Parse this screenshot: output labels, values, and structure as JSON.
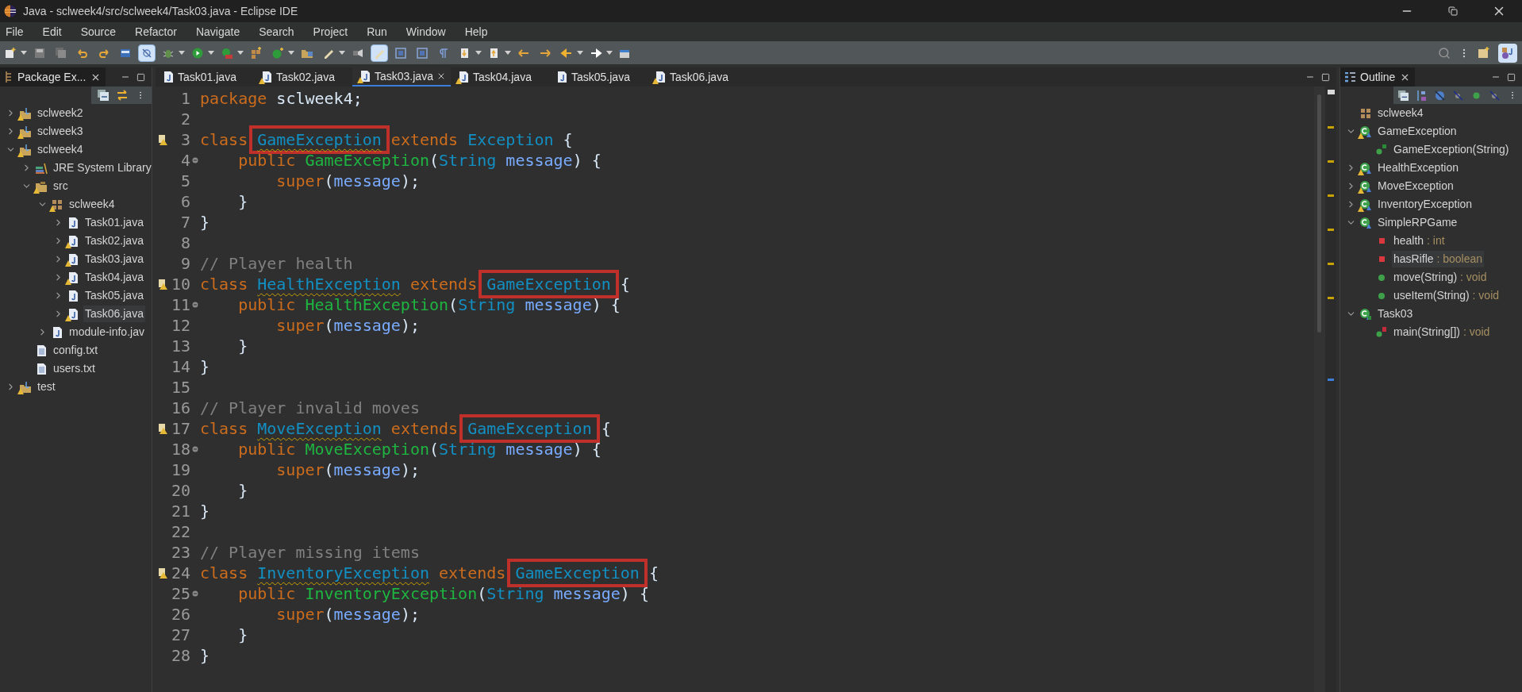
{
  "window": {
    "title": "Java - sclweek4/src/sclweek4/Task03.java - Eclipse IDE"
  },
  "menu": [
    "File",
    "Edit",
    "Source",
    "Refactor",
    "Navigate",
    "Search",
    "Project",
    "Run",
    "Window",
    "Help"
  ],
  "toolbar": [
    {
      "kind": "new",
      "on": false,
      "dropdown": true
    },
    {
      "kind": "save",
      "on": false
    },
    {
      "kind": "saveall",
      "on": false
    },
    {
      "kind": "undo",
      "on": false
    },
    {
      "kind": "redo",
      "on": false
    },
    {
      "kind": "console",
      "on": false
    },
    {
      "kind": "skip",
      "on": true
    },
    {
      "kind": "debug",
      "on": false,
      "dropdown": true
    },
    {
      "kind": "run",
      "on": false,
      "dropdown": true
    },
    {
      "kind": "coverage",
      "on": false,
      "dropdown": true
    },
    {
      "kind": "package",
      "on": false
    },
    {
      "kind": "newclass",
      "on": false,
      "dropdown": true
    },
    {
      "kind": "open",
      "on": false
    },
    {
      "kind": "marker",
      "on": false,
      "dropdown": true
    },
    {
      "kind": "search",
      "on": false
    },
    {
      "kind": "marker",
      "on": true
    },
    {
      "kind": "block",
      "on": false
    },
    {
      "kind": "block",
      "on": false
    },
    {
      "kind": "paragraph",
      "on": false
    },
    {
      "kind": "nextann",
      "on": false,
      "dropdown": true
    },
    {
      "kind": "prevann",
      "on": false,
      "dropdown": true
    },
    {
      "kind": "backedit",
      "on": false
    },
    {
      "kind": "fwdedit",
      "on": false
    },
    {
      "kind": "back",
      "on": false,
      "dropdown": true
    },
    {
      "kind": "forward",
      "on": false,
      "dropdown": true
    },
    {
      "kind": "newwin",
      "on": false
    }
  ],
  "package_explorer": {
    "title": "Package Ex...",
    "tree": [
      {
        "label": "sclweek2",
        "kind": "project",
        "warning": true,
        "expanded": false,
        "selected": false
      },
      {
        "label": "sclweek3",
        "kind": "project",
        "warning": true,
        "expanded": false,
        "selected": false
      },
      {
        "label": "sclweek4",
        "kind": "project",
        "warning": true,
        "expanded": true,
        "selected": false,
        "children": [
          {
            "label": "JRE System Library",
            "kind": "library",
            "warning": false,
            "expanded": false,
            "selected": false
          },
          {
            "label": "src",
            "kind": "folder",
            "warning": true,
            "expanded": true,
            "selected": false,
            "children": [
              {
                "label": "sclweek4",
                "kind": "package",
                "warning": true,
                "expanded": true,
                "selected": false,
                "children": [
                  {
                    "label": "Task01.java",
                    "kind": "java",
                    "warning": false,
                    "expanded": false,
                    "selected": false
                  },
                  {
                    "label": "Task02.java",
                    "kind": "java",
                    "warning": true,
                    "expanded": false,
                    "selected": false
                  },
                  {
                    "label": "Task03.java",
                    "kind": "java",
                    "warning": true,
                    "expanded": false,
                    "selected": false
                  },
                  {
                    "label": "Task04.java",
                    "kind": "java",
                    "warning": true,
                    "expanded": false,
                    "selected": false
                  },
                  {
                    "label": "Task05.java",
                    "kind": "java",
                    "warning": false,
                    "expanded": false,
                    "selected": false
                  },
                  {
                    "label": "Task06.java",
                    "kind": "java",
                    "warning": true,
                    "expanded": false,
                    "selected": true
                  }
                ]
              },
              {
                "label": "module-info.jav",
                "kind": "java",
                "warning": false,
                "expanded": false,
                "selected": false
              }
            ]
          },
          {
            "label": "config.txt",
            "kind": "text",
            "warning": false,
            "selected": false
          },
          {
            "label": "users.txt",
            "kind": "text",
            "warning": false,
            "selected": false
          }
        ]
      },
      {
        "label": "test",
        "kind": "project",
        "warning": true,
        "expanded": false,
        "selected": false
      }
    ]
  },
  "editor": {
    "tabs": [
      {
        "label": "Task01.java",
        "warning": false,
        "selected": false
      },
      {
        "label": "Task02.java",
        "warning": true,
        "selected": false
      },
      {
        "label": "Task03.java",
        "warning": true,
        "selected": true
      },
      {
        "label": "Task04.java",
        "warning": true,
        "selected": false
      },
      {
        "label": "Task05.java",
        "warning": false,
        "selected": false
      },
      {
        "label": "Task06.java",
        "warning": true,
        "selected": false
      }
    ],
    "lines": [
      {
        "number": "1",
        "tokens": [
          {
            "text": "package",
            "kind": "keyword"
          },
          {
            "text": " sclweek4;",
            "kind": "plain"
          }
        ]
      },
      {
        "number": "2"
      },
      {
        "number": "3",
        "warning": true,
        "tokens": [
          {
            "text": "class ",
            "kind": "keyword"
          },
          {
            "text": "GameException",
            "kind": "type",
            "squiggle": true,
            "boxed": true
          },
          {
            "text": " extends ",
            "kind": "keyword"
          },
          {
            "text": "Exception",
            "kind": "type"
          },
          {
            "text": " {",
            "kind": "plain"
          }
        ]
      },
      {
        "number": "4",
        "fold": true,
        "tokens": [
          {
            "text": "    public ",
            "kind": "keyword"
          },
          {
            "text": "GameException",
            "kind": "ctor"
          },
          {
            "text": "(",
            "kind": "plain"
          },
          {
            "text": "String",
            "kind": "type"
          },
          {
            "text": " message",
            "kind": "param"
          },
          {
            "text": ") {",
            "kind": "plain"
          }
        ]
      },
      {
        "number": "5",
        "tokens": [
          {
            "text": "        super",
            "kind": "keyword"
          },
          {
            "text": "(",
            "kind": "plain"
          },
          {
            "text": "message",
            "kind": "param"
          },
          {
            "text": ");",
            "kind": "plain"
          }
        ]
      },
      {
        "number": "6",
        "tokens": [
          {
            "text": "    }",
            "kind": "plain"
          }
        ]
      },
      {
        "number": "7",
        "tokens": [
          {
            "text": "}",
            "kind": "plain"
          }
        ]
      },
      {
        "number": "8"
      },
      {
        "number": "9",
        "tokens": [
          {
            "text": "// Player health",
            "kind": "comment"
          }
        ]
      },
      {
        "number": "10",
        "warning": true,
        "tokens": [
          {
            "text": "class ",
            "kind": "keyword"
          },
          {
            "text": "HealthException",
            "kind": "type",
            "squiggle": true
          },
          {
            "text": " extends ",
            "kind": "keyword"
          },
          {
            "text": "GameException",
            "kind": "type",
            "boxed": true
          },
          {
            "text": " {",
            "kind": "plain"
          }
        ]
      },
      {
        "number": "11",
        "fold": true,
        "tokens": [
          {
            "text": "    public ",
            "kind": "keyword"
          },
          {
            "text": "HealthException",
            "kind": "ctor"
          },
          {
            "text": "(",
            "kind": "plain"
          },
          {
            "text": "String",
            "kind": "type"
          },
          {
            "text": " message",
            "kind": "param"
          },
          {
            "text": ") {",
            "kind": "plain"
          }
        ]
      },
      {
        "number": "12",
        "tokens": [
          {
            "text": "        super",
            "kind": "keyword"
          },
          {
            "text": "(",
            "kind": "plain"
          },
          {
            "text": "message",
            "kind": "param"
          },
          {
            "text": ");",
            "kind": "plain"
          }
        ]
      },
      {
        "number": "13",
        "tokens": [
          {
            "text": "    }",
            "kind": "plain"
          }
        ]
      },
      {
        "number": "14",
        "tokens": [
          {
            "text": "}",
            "kind": "plain"
          }
        ]
      },
      {
        "number": "15"
      },
      {
        "number": "16",
        "tokens": [
          {
            "text": "// Player invalid moves",
            "kind": "comment"
          }
        ]
      },
      {
        "number": "17",
        "warning": true,
        "tokens": [
          {
            "text": "class ",
            "kind": "keyword"
          },
          {
            "text": "MoveException",
            "kind": "type",
            "squiggle": true
          },
          {
            "text": " extends ",
            "kind": "keyword"
          },
          {
            "text": "GameException",
            "kind": "type",
            "boxed": true
          },
          {
            "text": " {",
            "kind": "plain"
          }
        ]
      },
      {
        "number": "18",
        "fold": true,
        "tokens": [
          {
            "text": "    public ",
            "kind": "keyword"
          },
          {
            "text": "MoveException",
            "kind": "ctor"
          },
          {
            "text": "(",
            "kind": "plain"
          },
          {
            "text": "String",
            "kind": "type"
          },
          {
            "text": " message",
            "kind": "param"
          },
          {
            "text": ") {",
            "kind": "plain"
          }
        ]
      },
      {
        "number": "19",
        "tokens": [
          {
            "text": "        super",
            "kind": "keyword"
          },
          {
            "text": "(",
            "kind": "plain"
          },
          {
            "text": "message",
            "kind": "param"
          },
          {
            "text": ");",
            "kind": "plain"
          }
        ]
      },
      {
        "number": "20",
        "tokens": [
          {
            "text": "    }",
            "kind": "plain"
          }
        ]
      },
      {
        "number": "21",
        "tokens": [
          {
            "text": "}",
            "kind": "plain"
          }
        ]
      },
      {
        "number": "22"
      },
      {
        "number": "23",
        "tokens": [
          {
            "text": "// Player missing items",
            "kind": "comment"
          }
        ]
      },
      {
        "number": "24",
        "warning": true,
        "tokens": [
          {
            "text": "class ",
            "kind": "keyword"
          },
          {
            "text": "InventoryException",
            "kind": "type",
            "squiggle": true
          },
          {
            "text": " extends ",
            "kind": "keyword"
          },
          {
            "text": "GameException",
            "kind": "type",
            "boxed": true
          },
          {
            "text": " {",
            "kind": "plain"
          }
        ]
      },
      {
        "number": "25",
        "fold": true,
        "tokens": [
          {
            "text": "    public ",
            "kind": "keyword"
          },
          {
            "text": "InventoryException",
            "kind": "ctor"
          },
          {
            "text": "(",
            "kind": "plain"
          },
          {
            "text": "String",
            "kind": "type"
          },
          {
            "text": " message",
            "kind": "param"
          },
          {
            "text": ") {",
            "kind": "plain"
          }
        ]
      },
      {
        "number": "26",
        "tokens": [
          {
            "text": "        super",
            "kind": "keyword"
          },
          {
            "text": "(",
            "kind": "plain"
          },
          {
            "text": "message",
            "kind": "param"
          },
          {
            "text": ");",
            "kind": "plain"
          }
        ]
      },
      {
        "number": "27",
        "tokens": [
          {
            "text": "    }",
            "kind": "plain"
          }
        ]
      },
      {
        "number": "28",
        "tokens": [
          {
            "text": "}",
            "kind": "plain"
          }
        ]
      }
    ]
  },
  "outline": {
    "title": "Outline",
    "tree": [
      {
        "label": "sclweek4",
        "kind": "package",
        "warning": false,
        "selected": false
      },
      {
        "label": "GameException",
        "kind": "class",
        "warning": true,
        "expanded": true,
        "selected": false,
        "children": [
          {
            "label": "GameException(String)",
            "kind": "constructor",
            "warning": false,
            "selected": false
          }
        ]
      },
      {
        "label": "HealthException",
        "kind": "class",
        "warning": true,
        "expanded": false,
        "selected": false
      },
      {
        "label": "MoveException",
        "kind": "class",
        "warning": true,
        "expanded": false,
        "selected": false
      },
      {
        "label": "InventoryException",
        "kind": "class",
        "warning": true,
        "expanded": false,
        "selected": false
      },
      {
        "label": "SimpleRPGame",
        "kind": "class",
        "warning": false,
        "expanded": true,
        "selected": false,
        "children": [
          {
            "label": "health",
            "type": " : int",
            "kind": "field",
            "warning": false,
            "selected": false
          },
          {
            "label": "hasRifle",
            "type": " : boolean",
            "kind": "field",
            "warning": false,
            "selected": true
          },
          {
            "label": "move(String)",
            "type": " : void",
            "kind": "method",
            "warning": false,
            "selected": false
          },
          {
            "label": "useItem(String)",
            "type": " : void",
            "kind": "method",
            "warning": false,
            "selected": false
          }
        ]
      },
      {
        "label": "Task03",
        "kind": "main-class",
        "warning": false,
        "expanded": true,
        "selected": false,
        "children": [
          {
            "label": "main(String[])",
            "type": " : void",
            "kind": "static-method",
            "warning": false,
            "selected": false
          }
        ]
      }
    ]
  }
}
